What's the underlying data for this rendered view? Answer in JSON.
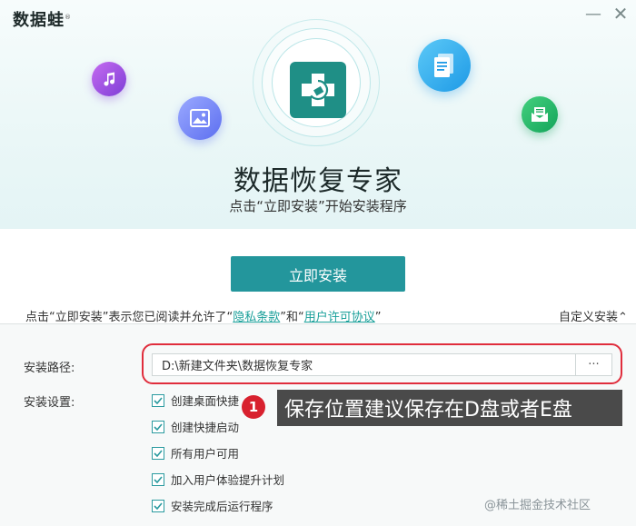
{
  "brand": {
    "name": "数据蛙",
    "mark": "®"
  },
  "window": {
    "minimize_glyph": "—",
    "close_glyph": "✕"
  },
  "hero": {
    "title": "数据恢复专家",
    "subtitle": "点击“立即安装”开始安装程序",
    "icons": [
      "music-icon",
      "image-icon",
      "document-icon",
      "mail-icon"
    ]
  },
  "install": {
    "button_label": "立即安装"
  },
  "agreement": {
    "prefix": "点击“立即安装”表示您已阅读并允许了“",
    "privacy_link": "隐私条款",
    "middle": "”和“",
    "license_link": "用户许可协议",
    "suffix": "”"
  },
  "custom_install": {
    "label": "自定义安装",
    "chevron": "⌃"
  },
  "settings": {
    "path_label": "安装路径:",
    "path_value": "D:\\新建文件夹\\数据恢复专家",
    "browse_label": "···",
    "options_label": "安装设置:",
    "options": [
      {
        "label": "创建桌面快捷",
        "checked": true
      },
      {
        "label": "创建快捷启动",
        "checked": true
      },
      {
        "label": "所有用户可用",
        "checked": true
      },
      {
        "label": "加入用户体验提升计划",
        "checked": true
      },
      {
        "label": "安装完成后运行程序",
        "checked": true
      }
    ]
  },
  "annotation": {
    "number": "1",
    "text": "保存位置建议保存在D盘或者E盘",
    "color": "#d8212e"
  },
  "watermark": "@稀土掘金技术社区",
  "colors": {
    "accent": "#23969c",
    "link": "#1aa09a",
    "highlight": "#e02d3c"
  }
}
